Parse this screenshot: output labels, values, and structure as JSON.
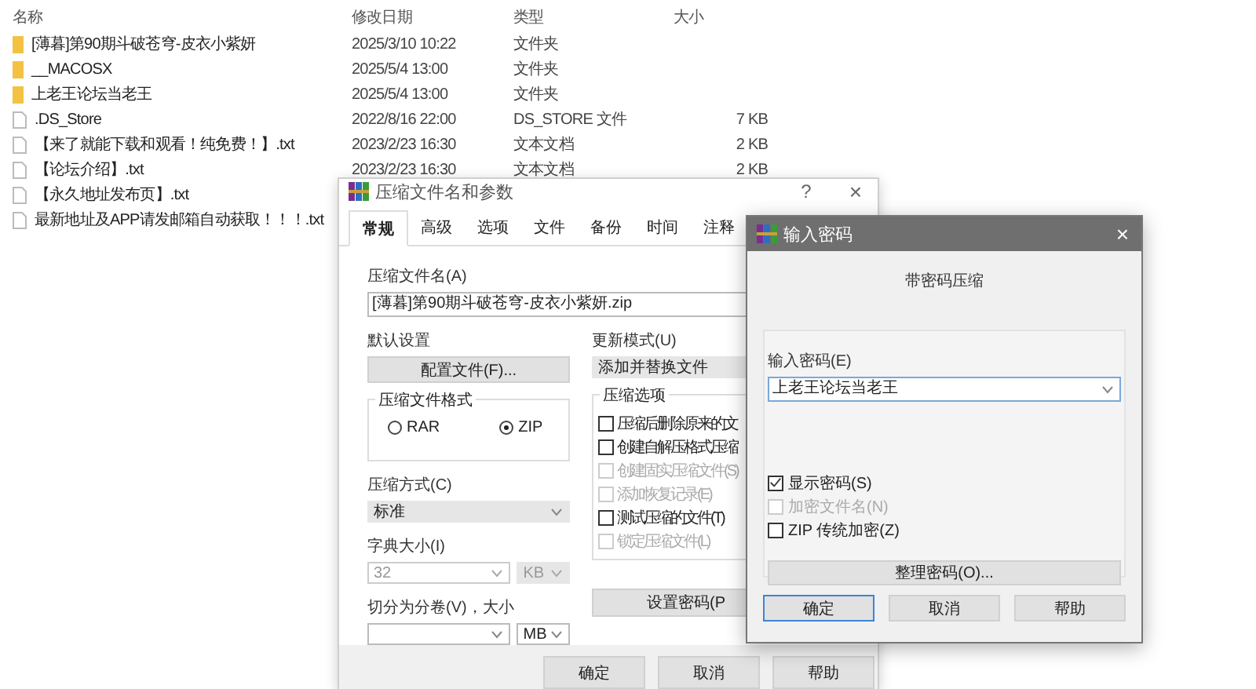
{
  "explorer": {
    "columns": [
      "名称",
      "修改日期",
      "类型",
      "大小"
    ],
    "rows": [
      {
        "kind": "folder",
        "name": "[薄暮]第90期斗破苍穹-皮衣小紫妍",
        "modified": "2025/3/10 10:22",
        "type": "文件夹"
      },
      {
        "kind": "folder",
        "name": "__MACOSX",
        "modified": "2025/5/4 13:00",
        "type": "文件夹"
      },
      {
        "kind": "folder",
        "name": "上老王论坛当老王",
        "modified": "2025/5/4 13:00",
        "type": "文件夹"
      },
      {
        "kind": "file",
        "name": ".DS_Store",
        "modified": "2022/8/16 22:00",
        "type": "DS_STORE 文件",
        "size": "7 KB"
      },
      {
        "kind": "file",
        "name": "【来了就能下载和观看！纯免费！】.txt",
        "modified": "2023/2/23 16:30",
        "type": "文本文档",
        "size": "2 KB"
      },
      {
        "kind": "file",
        "name": "【论坛介绍】.txt",
        "modified": "2023/2/23 16:30",
        "type": "文本文档",
        "size": "2 KB"
      },
      {
        "kind": "file",
        "name": "【永久地址发布页】.txt"
      },
      {
        "kind": "file",
        "name": "最新地址及APP请发邮箱自动获取！！！.txt"
      }
    ]
  },
  "archive_dialog": {
    "title": "压缩文件名和参数",
    "help": "?",
    "close": "×",
    "tabs": [
      {
        "label": "常规",
        "selected": true
      },
      {
        "label": "高级",
        "selected": false
      },
      {
        "label": "选项",
        "selected": false
      },
      {
        "label": "文件",
        "selected": false
      },
      {
        "label": "备份",
        "selected": false
      },
      {
        "label": "时间",
        "selected": false
      },
      {
        "label": "注释",
        "selected": false
      }
    ],
    "archive_name_label": "压缩文件名(A)",
    "archive_name": "[薄暮]第90期斗破苍穹-皮衣小紫妍.zip",
    "profile_label": "默认设置",
    "profile_button": "配置文件(F)...",
    "update_label": "更新模式(U)",
    "update_mode": "添加并替换文件",
    "format_label": "压缩文件格式",
    "formats": [
      {
        "label": "RAR",
        "selected": false
      },
      {
        "label": "ZIP",
        "selected": true
      }
    ],
    "method_label": "压缩方式(C)",
    "method": "标准",
    "dict_label": "字典大小(I)",
    "dict_size": "32",
    "dict_unit": "KB",
    "split_label": "切分为分卷(V)，大小",
    "split_unit": "MB",
    "options_label": "压缩选项",
    "options": [
      {
        "label": "压缩后删除原来的文",
        "checked": false,
        "disabled": false
      },
      {
        "label": "创建自解压格式压缩",
        "checked": false,
        "disabled": false
      },
      {
        "label": "创建固实压缩文件(S)",
        "checked": false,
        "disabled": true
      },
      {
        "label": "添加恢复记录(E)",
        "checked": false,
        "disabled": true
      },
      {
        "label": "测试压缩的文件(T)",
        "checked": false,
        "disabled": false
      },
      {
        "label": "锁定压缩文件(L)",
        "checked": false,
        "disabled": true
      }
    ],
    "password_button": "设置密码(P",
    "buttons": [
      "确定",
      "取消",
      "帮助"
    ]
  },
  "password_dialog": {
    "title": "输入密码",
    "close": "×",
    "heading": "带密码压缩",
    "password_label": "输入密码(E)",
    "password": "上老王论坛当老王",
    "options": [
      {
        "label": "显示密码(S)",
        "checked": true,
        "disabled": false
      },
      {
        "label": "加密文件名(N)",
        "checked": false,
        "disabled": true
      },
      {
        "label": "ZIP 传统加密(Z)",
        "checked": false,
        "disabled": false
      }
    ],
    "organize_button": "整理密码(O)...",
    "buttons": [
      "确定",
      "取消",
      "帮助"
    ]
  }
}
